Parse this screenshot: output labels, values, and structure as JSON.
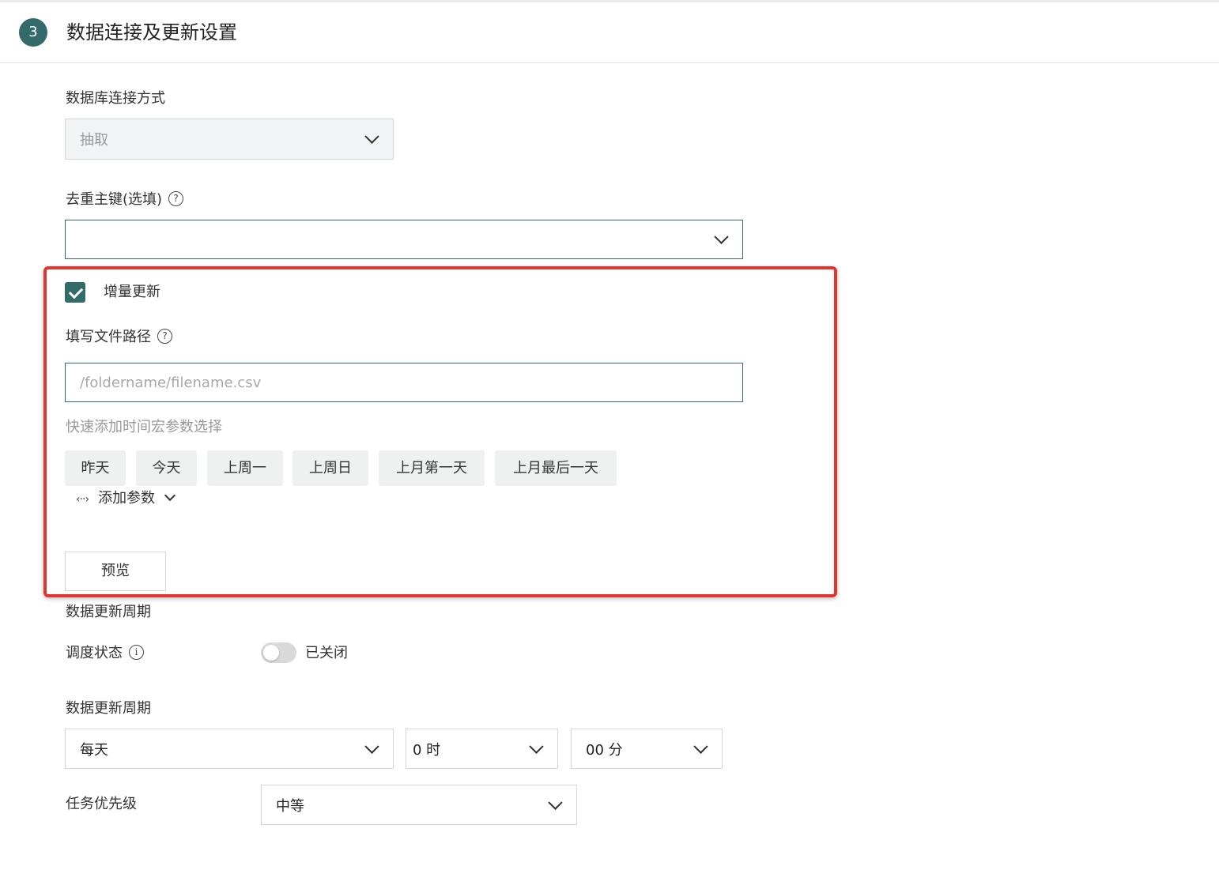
{
  "header": {
    "step_number": "3",
    "title": "数据连接及更新设置"
  },
  "connection": {
    "label": "数据库连接方式",
    "value": "抽取"
  },
  "dedup_key": {
    "label": "去重主键(选填)",
    "help_icon": "?",
    "value": ""
  },
  "incremental": {
    "checkbox_label": "增量更新",
    "checked": true,
    "path_label": "填写文件路径",
    "help_icon": "?",
    "path_placeholder": "/foldername/filename.csv",
    "macro_label": "快速添加时间宏参数选择",
    "macro_chips": [
      "昨天",
      "今天",
      "上周一",
      "上周日",
      "上月第一天",
      "上月最后一天"
    ],
    "add_param_icon": "‹··›",
    "add_param_label": "添加参数",
    "preview_button": "预览"
  },
  "schedule": {
    "section_label": "数据更新周期",
    "status_label": "调度状态",
    "info_icon": "i",
    "toggle_on": false,
    "toggle_text": "已关闭",
    "period_label": "数据更新周期",
    "period_value": "每天",
    "hour_value": "0 时",
    "minute_value": "00 分",
    "priority_label": "任务优先级",
    "priority_value": "中等"
  },
  "colors": {
    "accent": "#336b6b",
    "highlight_box": "#e3342f"
  }
}
